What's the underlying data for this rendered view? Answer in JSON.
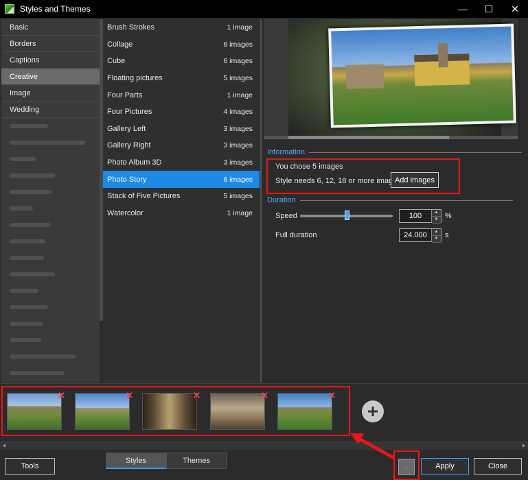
{
  "window": {
    "title": "Styles and Themes",
    "controls": [
      "—",
      "☐",
      "✕"
    ]
  },
  "categories": {
    "items": [
      "Basic",
      "Borders",
      "Captions",
      "Creative",
      "Image",
      "Wedding"
    ],
    "selected": "Creative"
  },
  "styles": [
    {
      "name": "Brush Strokes",
      "count": "1 image"
    },
    {
      "name": "Collage",
      "count": "6 images"
    },
    {
      "name": "Cube",
      "count": "6 images"
    },
    {
      "name": "Floating pictures",
      "count": "5 images"
    },
    {
      "name": "Four Parts",
      "count": "1 image"
    },
    {
      "name": "Four Pictures",
      "count": "4 images"
    },
    {
      "name": "Gallery Left",
      "count": "3 images"
    },
    {
      "name": "Gallery Right",
      "count": "3 images"
    },
    {
      "name": "Photo Album 3D",
      "count": "3 images"
    },
    {
      "name": "Photo Story",
      "count": "6 images"
    },
    {
      "name": "Stack of Five Pictures",
      "count": "5 images"
    },
    {
      "name": "Watercolor",
      "count": "1 image"
    }
  ],
  "selected_style": "Photo Story",
  "information": {
    "heading": "Information",
    "chosen": "You chose 5 images",
    "needs": "Style needs 6, 12, 18 or more images",
    "add_button": "Add images"
  },
  "duration": {
    "heading": "Duration",
    "speed_label": "Speed",
    "speed_value": "100",
    "speed_unit": "%",
    "full_label": "Full duration",
    "full_value": "24.000",
    "full_unit": "s",
    "speed_slider_fraction": 0.5
  },
  "thumbnails": [
    "thumb-1",
    "thumb-2",
    "thumb-3",
    "thumb-4",
    "thumb-5"
  ],
  "remove_mark": "✕",
  "add_mark": "+",
  "scroll_arrows": {
    "left": "◂",
    "right": "▸"
  },
  "bottom_bar": {
    "tools": "Tools",
    "tab_styles": "Styles",
    "tab_themes": "Themes",
    "apply": "Apply",
    "close": "Close",
    "small_button": "·"
  },
  "colors": {
    "accent": "#1e8ae6",
    "section_heading": "#59a7ff",
    "highlight_box": "#e81717"
  }
}
